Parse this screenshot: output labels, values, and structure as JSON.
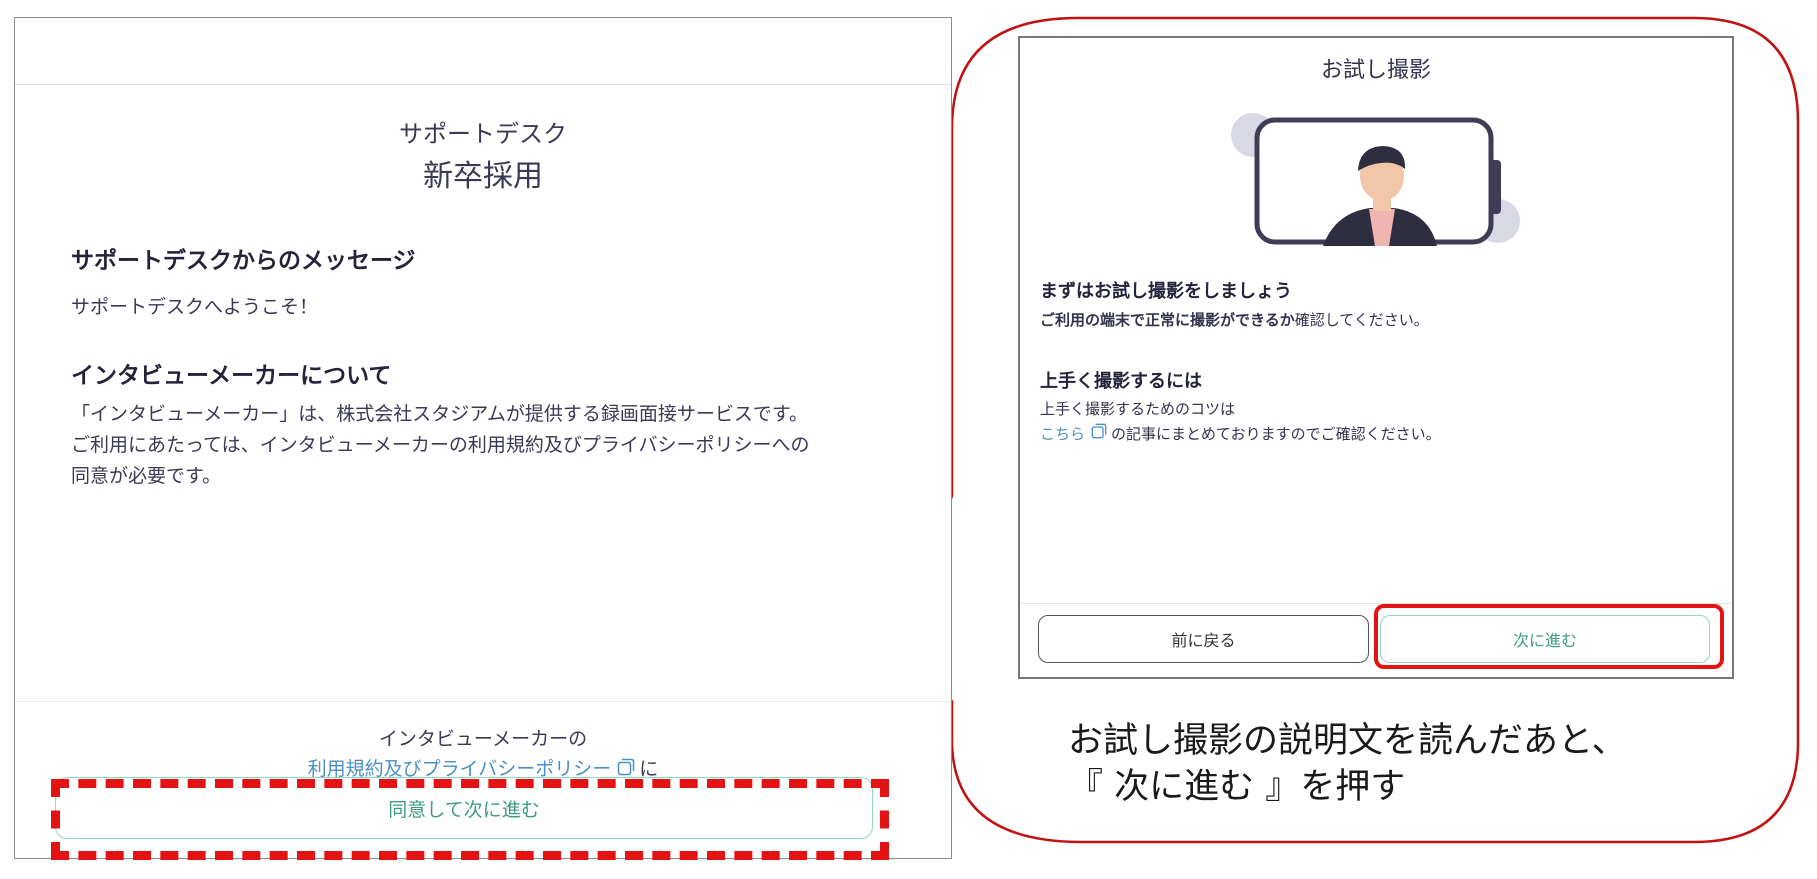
{
  "left": {
    "desk_name": "サポートデスク",
    "desk_subtitle": "新卒採用",
    "message_heading": "サポートデスクからのメッセージ",
    "message_text": "サポートデスクへようこそ！",
    "about_heading": "インタビューメーカーについて",
    "about_lines": [
      "「インタビューメーカー」は、株式会社スタジアムが提供する録画面接サービスです。",
      "ご利用にあたっては、インタビューメーカーの利用規約及びプライバシーポリシーへの",
      "同意が必要です。"
    ],
    "footer_line1": "インタビューメーカーの",
    "terms_link": "利用規約及びプライバシーポリシー",
    "footer_suffix": "に",
    "agree_button": "同意して次に進む"
  },
  "right": {
    "title": "お試し撮影",
    "heading1": "まずはお試し撮影をしましょう",
    "text1_bold": "ご利用の端末で正常に撮影ができるか",
    "text1_rest": "確認してください。",
    "heading2": "上手く撮影するには",
    "text2_line1": "上手く撮影するためのコツは",
    "text2_link": "こちら",
    "text2_rest": "の記事にまとめておりますのでご確認ください。",
    "back_button": "前に戻る",
    "next_button": "次に進む"
  },
  "caption": {
    "line1": "お試し撮影の説明文を読んだあと、",
    "line2": "『 次に進む 』を押す"
  },
  "icons": [
    "external-link-icon",
    "phone-illustration"
  ],
  "colors": {
    "highlight": "#e41313",
    "accent_green": "#3e9c83",
    "button_border_green": "#8fd8c4",
    "link_blue": "#4a90c4",
    "callout_border": "#c11212"
  }
}
